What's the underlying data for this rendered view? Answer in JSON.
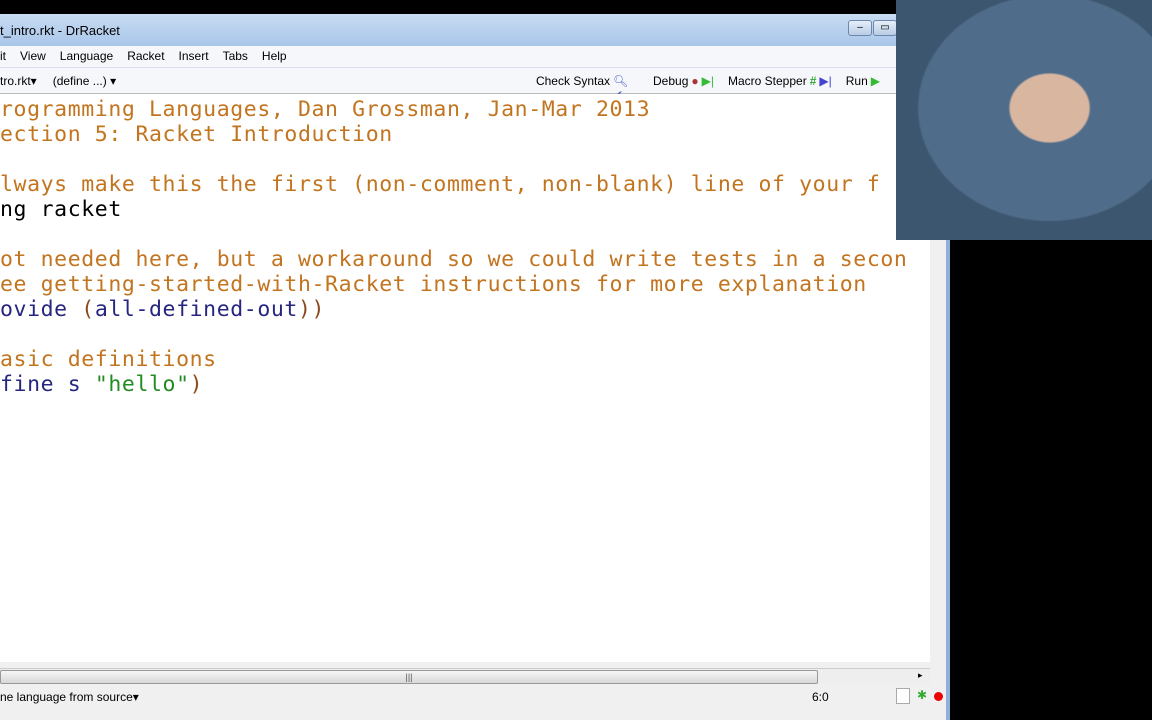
{
  "window": {
    "title": "t_intro.rkt - DrRacket",
    "min": "–",
    "max": "▭"
  },
  "menu": [
    "it",
    "View",
    "Language",
    "Racket",
    "Insert",
    "Tabs",
    "Help"
  ],
  "toolbar": {
    "file": "tro.rkt",
    "define": "(define ...)",
    "check_syntax": "Check Syntax",
    "debug": "Debug",
    "macro_stepper": "Macro Stepper",
    "run": "Run"
  },
  "code": [
    [
      [
        "c",
        "rogramming Languages, Dan Grossman, Jan-Mar 2013"
      ]
    ],
    [
      [
        "c",
        "ection 5: Racket Introduction"
      ]
    ],
    [],
    [
      [
        "c",
        "lways make this the first (non-comment, non-blank) line of your f"
      ]
    ],
    [
      [
        "k",
        "ng racket"
      ]
    ],
    [],
    [
      [
        "c",
        "ot needed here, but a workaround so we could write tests in a secon"
      ]
    ],
    [
      [
        "c",
        "ee getting-started-with-Racket instructions for more explanation"
      ]
    ],
    [
      [
        "id",
        "ovide "
      ],
      [
        "p",
        "("
      ],
      [
        "id",
        "all-defined-out"
      ],
      [
        "p",
        "))"
      ]
    ],
    [],
    [
      [
        "c",
        "asic definitions"
      ]
    ],
    [
      [
        "id",
        "fine s "
      ],
      [
        "s",
        "\"hello\""
      ],
      [
        "p",
        ")"
      ]
    ]
  ],
  "status": {
    "language": "ne language from source",
    "position": "6:0"
  },
  "colors": {
    "comment": "#c2741f",
    "identifier": "#262680",
    "paren": "#8b4a1e",
    "string": "#228b22"
  },
  "webcam": "presenter video overlay"
}
